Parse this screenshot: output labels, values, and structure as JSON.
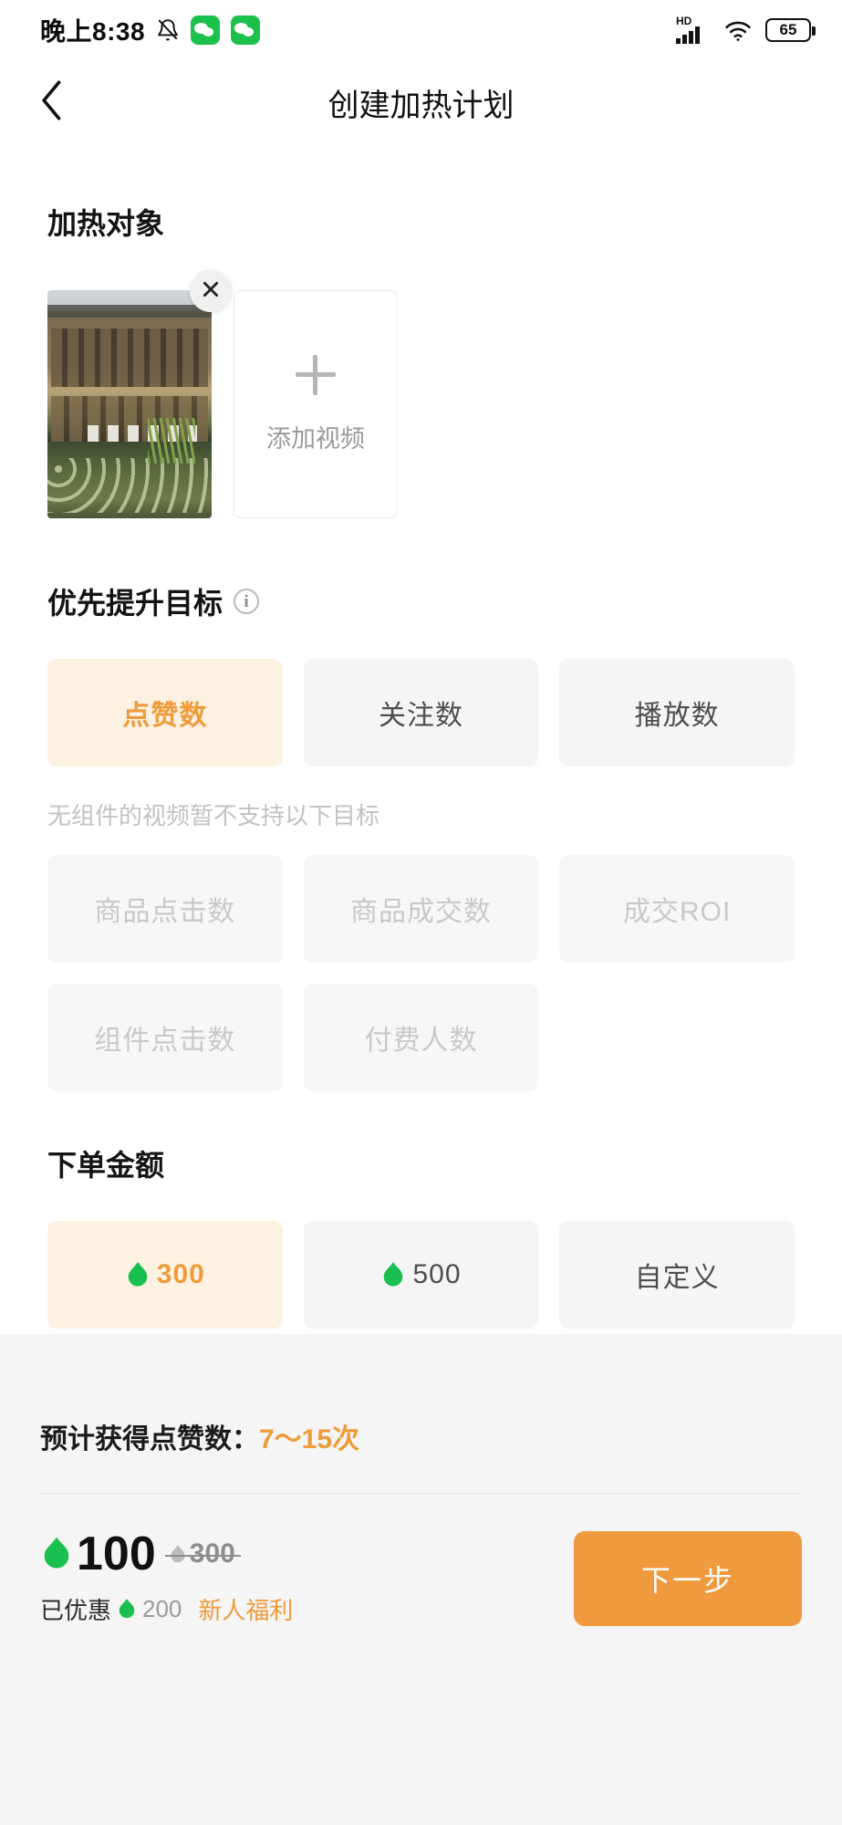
{
  "statusbar": {
    "time": "晚上8:38",
    "mute_icon": "bell-muted-icon",
    "app_icon_1": "wechat-icon",
    "app_icon_2": "wechat-icon",
    "hd_label": "HD",
    "signal_icon": "signal-bars-icon",
    "wifi_icon": "wifi-icon",
    "battery_level": "65"
  },
  "navbar": {
    "back_icon": "chevron-left-icon",
    "title": "创建加热计划"
  },
  "target_section": {
    "title": "加热对象",
    "thumbnail_alt": "video-thumbnail",
    "remove_icon": "close-icon",
    "add_icon": "plus-icon",
    "add_label": "添加视频"
  },
  "goal_section": {
    "title": "优先提升目标",
    "info_icon": "info-icon",
    "options": [
      {
        "label": "点赞数",
        "state": "selected"
      },
      {
        "label": "关注数",
        "state": "enabled"
      },
      {
        "label": "播放数",
        "state": "enabled"
      }
    ],
    "disabled_hint": "无组件的视频暂不支持以下目标",
    "disabled_options": [
      {
        "label": "商品点击数",
        "state": "disabled"
      },
      {
        "label": "商品成交数",
        "state": "disabled"
      },
      {
        "label": "成交ROI",
        "state": "disabled"
      },
      {
        "label": "组件点击数",
        "state": "disabled"
      },
      {
        "label": "付费人数",
        "state": "disabled"
      }
    ]
  },
  "amount_section": {
    "title": "下单金额",
    "coin_icon": "green-coin-icon",
    "options": [
      {
        "label": "300",
        "has_coin": true,
        "state": "selected"
      },
      {
        "label": "500",
        "has_coin": true,
        "state": "enabled"
      },
      {
        "label": "自定义",
        "has_coin": false,
        "state": "enabled"
      }
    ]
  },
  "summary": {
    "estimate_label": "预计获得点赞数：",
    "estimate_value": "7〜15次",
    "price_coin_icon": "green-coin-icon",
    "price": "100",
    "original_price": "300",
    "discount_label": "已优惠",
    "discount_value": "200",
    "discount_tag": "新人福利",
    "next_button": "下一步"
  },
  "colors": {
    "accent_orange": "#ee9b38",
    "selected_bg": "#fdf2e2",
    "coin_green": "#1bbf4f",
    "chip_bg": "#f5f5f5",
    "panel_bg": "#f5f5f5"
  }
}
